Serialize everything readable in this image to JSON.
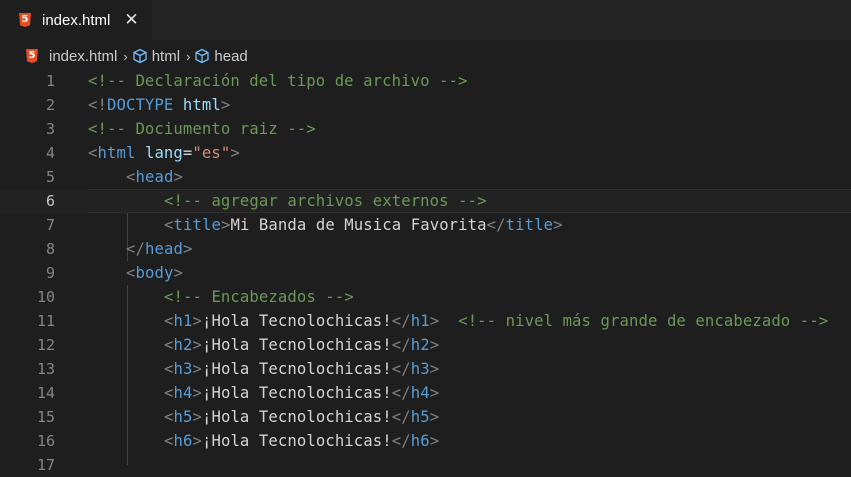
{
  "tab": {
    "label": "index.html",
    "close": "✕",
    "icon": "html5-icon"
  },
  "breadcrumb": {
    "file": "index.html",
    "item1": "html",
    "item2": "head",
    "separator": "›"
  },
  "editor": {
    "active_line": 6,
    "line_numbers": [
      "1",
      "2",
      "3",
      "4",
      "5",
      "6",
      "7",
      "8",
      "9",
      "10",
      "11",
      "12",
      "13",
      "14",
      "15",
      "16",
      "17"
    ],
    "lines": {
      "l1": {
        "comment": "<!-- Declaración del tipo de archivo -->"
      },
      "l2": {
        "open": "<!",
        "doctype": "DOCTYPE",
        "space": " ",
        "name": "html",
        "close": ">"
      },
      "l3": {
        "comment": "<!-- Dociumento raiz -->"
      },
      "l4": {
        "open": "<",
        "tag": "html",
        "space": " ",
        "attr": "lang",
        "eq": "=",
        "value": "\"es\"",
        "close": ">"
      },
      "l5": {
        "open": "<",
        "tag": "head",
        "close": ">"
      },
      "l6": {
        "comment": "<!-- agregar archivos externos -->"
      },
      "l7": {
        "open": "<",
        "tag": "title",
        "close": ">",
        "text": "Mi Banda de Musica Favorita",
        "end_open": "</",
        "end_tag": "title",
        "end_close": ">"
      },
      "l8": {
        "open": "</",
        "tag": "head",
        "close": ">"
      },
      "l9": {
        "open": "<",
        "tag": "body",
        "close": ">"
      },
      "l10": {
        "comment": "<!-- Encabezados -->"
      },
      "l11": {
        "open": "<",
        "tag": "h1",
        "close": ">",
        "text": "¡Hola Tecnolochicas!",
        "end_open": "</",
        "end_tag": "h1",
        "end_close": ">",
        "gap": "  ",
        "comment": "<!-- nivel más grande de encabezado -->"
      },
      "l12": {
        "open": "<",
        "tag": "h2",
        "close": ">",
        "text": "¡Hola Tecnolochicas!",
        "end_open": "</",
        "end_tag": "h2",
        "end_close": ">"
      },
      "l13": {
        "open": "<",
        "tag": "h3",
        "close": ">",
        "text": "¡Hola Tecnolochicas!",
        "end_open": "</",
        "end_tag": "h3",
        "end_close": ">"
      },
      "l14": {
        "open": "<",
        "tag": "h4",
        "close": ">",
        "text": "¡Hola Tecnolochicas!",
        "end_open": "</",
        "end_tag": "h4",
        "end_close": ">"
      },
      "l15": {
        "open": "<",
        "tag": "h5",
        "close": ">",
        "text": "¡Hola Tecnolochicas!",
        "end_open": "</",
        "end_tag": "h5",
        "end_close": ">"
      },
      "l16": {
        "open": "<",
        "tag": "h6",
        "close": ">",
        "text": "¡Hola Tecnolochicas!",
        "end_open": "</",
        "end_tag": "h6",
        "end_close": ">"
      }
    }
  },
  "colors": {
    "background": "#1e1e1e",
    "tab_bar": "#252526",
    "comment": "#6a9955",
    "tag": "#569cd6",
    "bracket": "#808080",
    "attribute": "#9cdcfe",
    "string": "#ce9178",
    "text": "#d4d4d4",
    "line_number": "#858585",
    "html5_icon": "#e44d26"
  }
}
